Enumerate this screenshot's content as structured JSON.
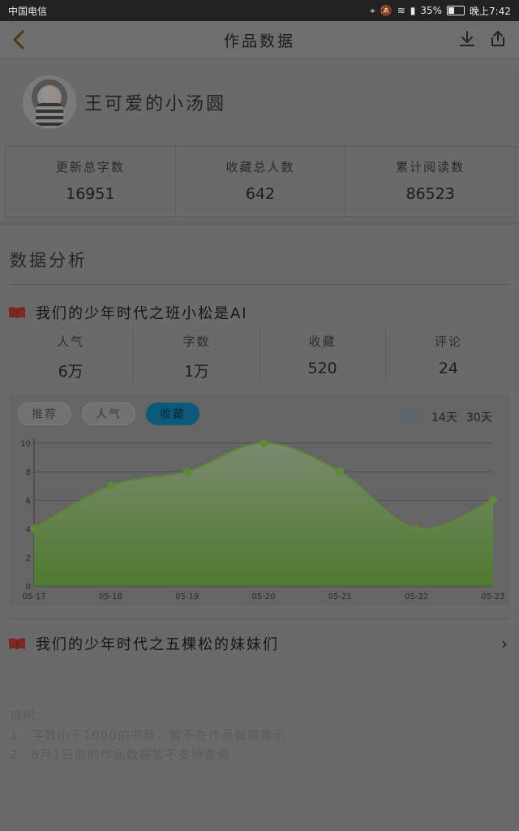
{
  "status_bar": {
    "carrier": "中国电信",
    "battery": "35%",
    "time": "晚上7:42"
  },
  "nav": {
    "title": "作品数据"
  },
  "profile": {
    "username": "王可爱的小汤圆"
  },
  "stats": [
    {
      "label": "更新总字数",
      "value": "16951"
    },
    {
      "label": "收藏总人数",
      "value": "642"
    },
    {
      "label": "累计阅读数",
      "value": "86523"
    }
  ],
  "analysis": {
    "title": "数据分析"
  },
  "book1": {
    "title": "我们的少年时代之班小松是AI",
    "metrics": [
      {
        "label": "人气",
        "value": "6万"
      },
      {
        "label": "字数",
        "value": "1万"
      },
      {
        "label": "收藏",
        "value": "520"
      },
      {
        "label": "评论",
        "value": "24"
      }
    ]
  },
  "chart_controls": {
    "tabs": [
      "推荐",
      "人气",
      "收藏"
    ],
    "active_tab": "收藏",
    "ranges": [
      "7天",
      "14天",
      "30天"
    ],
    "active_range": "7天"
  },
  "chart_data": {
    "type": "area",
    "x": [
      "05-17",
      "05-18",
      "05-19",
      "05-20",
      "05-21",
      "05-22",
      "05-23"
    ],
    "series": [
      {
        "values": [
          4,
          7,
          8,
          10,
          8,
          4,
          6
        ]
      }
    ],
    "ylim": [
      0,
      10
    ],
    "yticks": [
      0,
      2,
      4,
      6,
      8,
      10
    ],
    "grid": true,
    "colors": {
      "fill": "#4e7a2e",
      "line": "#5c8a36",
      "point": "#5c8a36"
    }
  },
  "book2": {
    "title": "我们的少年时代之五棵松的妹妹们"
  },
  "notes": {
    "heading": "说明：",
    "lines": [
      "1、字数小于1000的书籍，暂不在作品数据展示",
      "2、8月1日前的作品数据暂不支持查询"
    ]
  }
}
